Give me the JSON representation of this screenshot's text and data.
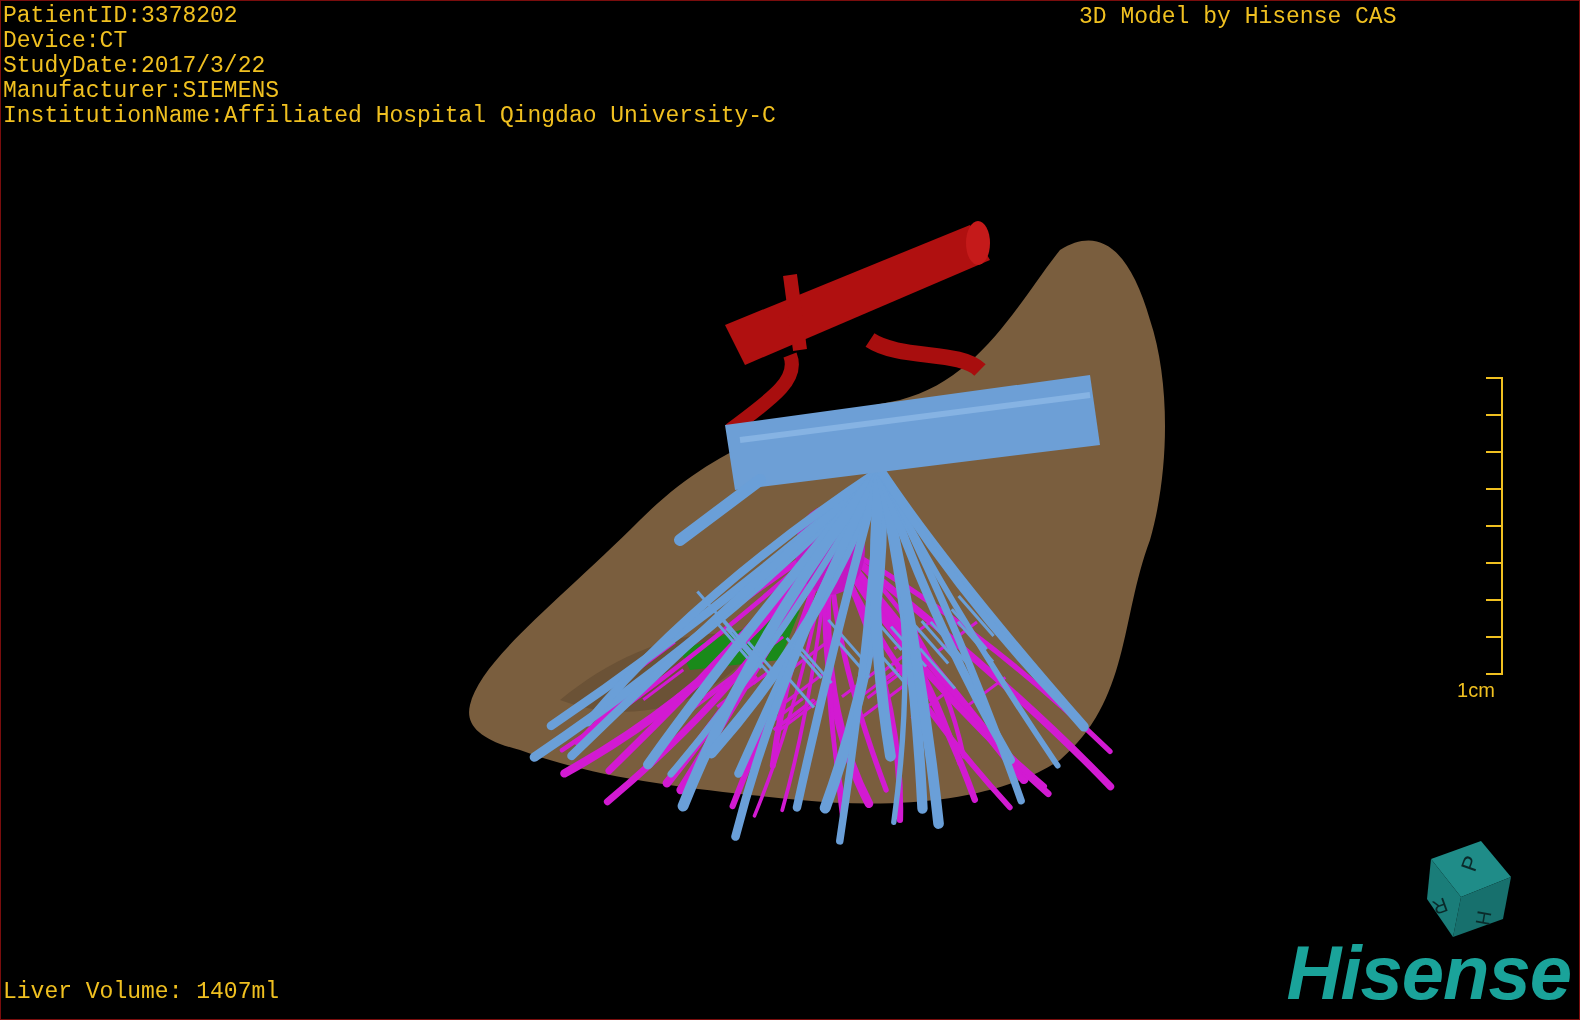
{
  "study_info": [
    "PatientID:3378202",
    "Device:CT",
    "StudyDate:2017/3/22",
    "Manufacturer:SIEMENS",
    "InstitutionName:Affiliated Hospital Qingdao University-C"
  ],
  "title": "3D Model by Hisense CAS",
  "scale_bar": {
    "label": "1cm"
  },
  "orientation_cube": {
    "faces": [
      "P",
      "H",
      "R"
    ]
  },
  "logo": "Hisense",
  "liver_volume": "Liver Volume: 1407ml"
}
